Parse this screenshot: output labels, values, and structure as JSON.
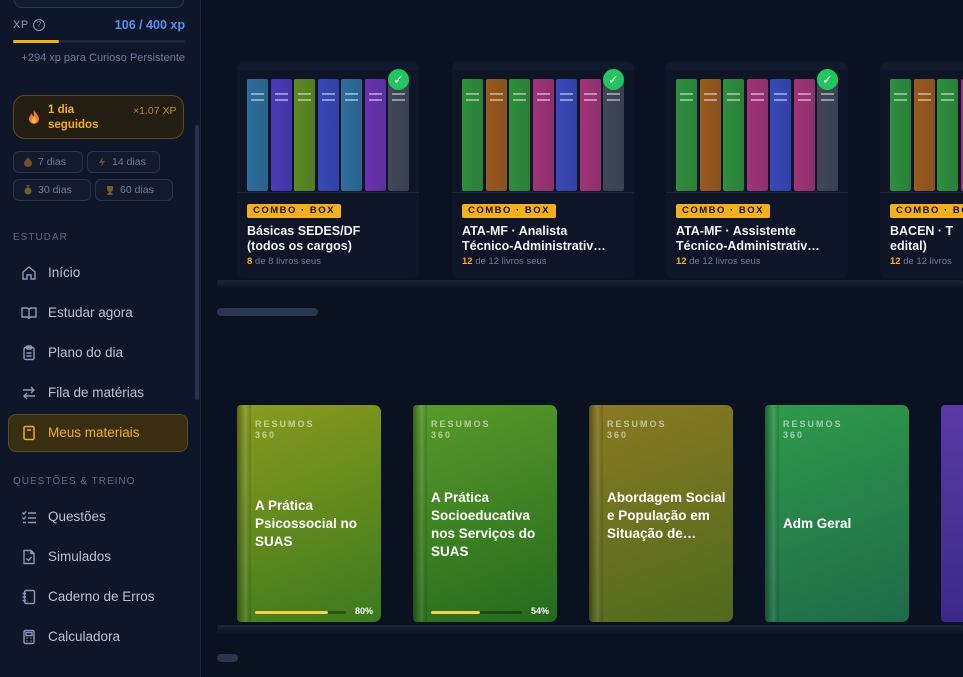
{
  "xp": {
    "label": "XP",
    "info_icon": "info-icon",
    "value": "106 / 400 xp",
    "progress_fraction": 0.265,
    "next_level_text": "+294 xp para Curioso Persistente"
  },
  "streak": {
    "icon": "fire-icon",
    "days_label": "1 dia seguidos",
    "multiplier_label": "×1.07 XP"
  },
  "badges": [
    {
      "icon": "flame-medal-icon",
      "label": "7 dias"
    },
    {
      "icon": "lightning-icon",
      "label": "14 dias"
    },
    {
      "icon": "medal-icon",
      "label": "30 dias"
    },
    {
      "icon": "trophy-icon",
      "label": "60 dias"
    }
  ],
  "sections": {
    "study": "ESTUDAR",
    "practice": "QUESTÕES & TREINO"
  },
  "nav": {
    "study": [
      {
        "label": "Início",
        "icon": "home-icon"
      },
      {
        "label": "Estudar agora",
        "icon": "book-open-icon"
      },
      {
        "label": "Plano do dia",
        "icon": "clipboard-icon"
      },
      {
        "label": "Fila de matérias",
        "icon": "swap-arrows-icon"
      },
      {
        "label": "Meus materiais",
        "icon": "book-icon",
        "active": true
      }
    ],
    "practice": [
      {
        "label": "Questões",
        "icon": "checklist-icon"
      },
      {
        "label": "Simulados",
        "icon": "file-check-icon"
      },
      {
        "label": "Caderno de Erros",
        "icon": "notebook-icon"
      },
      {
        "label": "Calculadora",
        "icon": "calculator-icon"
      }
    ]
  },
  "combos": [
    {
      "tag": "COMBO · BOX",
      "title_line1": "Básicas SEDES/DF",
      "title_line2": "(todos os cargos)",
      "count_num": "8",
      "count_text": " de 8 livros seus",
      "completed": true,
      "spine_colors": [
        "#2d6e9c",
        "#4a3bb8",
        "#5d8a22",
        "#3848b8",
        "#2d6e9c",
        "#6a32b0",
        "#404756"
      ]
    },
    {
      "tag": "COMBO · BOX",
      "title_line1": "ATA-MF · Analista",
      "title_line2": "Técnico-Administrativ…",
      "count_num": "12",
      "count_text": " de 12 livros seus",
      "completed": true,
      "spine_colors": [
        "#2f8f3c",
        "#9a5a1e",
        "#2f8f3c",
        "#a03478",
        "#3848b8",
        "#a03478",
        "#404756"
      ]
    },
    {
      "tag": "COMBO · BOX",
      "title_line1": "ATA-MF · Assistente",
      "title_line2": "Técnico-Administrativ…",
      "count_num": "12",
      "count_text": " de 12 livros seus",
      "completed": true,
      "spine_colors": [
        "#2f8f3c",
        "#9a5a1e",
        "#2f8f3c",
        "#a03478",
        "#3848b8",
        "#a03478",
        "#404756"
      ]
    },
    {
      "tag": "COMBO · BOX",
      "title_line1": "BACEN · T",
      "title_line2": "edital)",
      "count_num": "12",
      "count_text": " de 12 livros",
      "completed": false,
      "spine_colors": [
        "#2f8f3c",
        "#9a5a1e",
        "#2f8f3c",
        "#a03478",
        "#3848b8",
        "#a03478",
        "#404756"
      ]
    }
  ],
  "books": [
    {
      "series": "RESUMOS 360",
      "title": "A Prática Psicossocial no SUAS",
      "progress": 0.8,
      "progress_label": "80%",
      "color_top": "#8a9a1e",
      "color_bottom": "#3b7a1e"
    },
    {
      "series": "RESUMOS 360",
      "title": "A Prática Socioeducativa nos Serviços do SUAS",
      "progress": 0.54,
      "progress_label": "54%",
      "color_top": "#5a9a2a",
      "color_bottom": "#246a1e"
    },
    {
      "series": "RESUMOS 360",
      "title": "Abordagem Social e População em Situação de…",
      "progress": null,
      "progress_label": "",
      "color_top": "#8a7a22",
      "color_bottom": "#4e6a1e"
    },
    {
      "series": "RESUMOS 360",
      "title": "Adm Geral",
      "progress": null,
      "progress_label": "",
      "color_top": "#2f9a4a",
      "color_bottom": "#1e6a4a"
    }
  ],
  "colors": {
    "accent": "#f2b01e",
    "xp_blue": "#5b8def",
    "check_green": "#22c55e"
  }
}
